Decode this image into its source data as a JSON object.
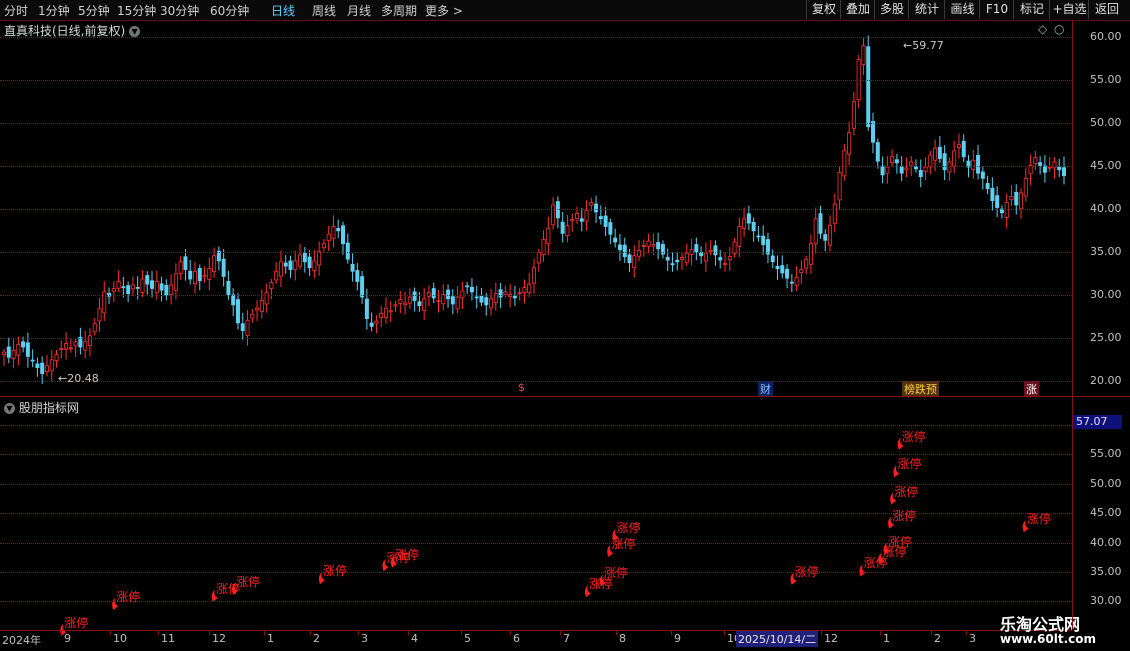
{
  "toolbar": {
    "periods": [
      "分时",
      "1分钟",
      "5分钟",
      "15分钟",
      "30分钟",
      "60分钟",
      "日线",
      "周线",
      "月线",
      "多周期",
      "更多 >"
    ],
    "active_period": "日线",
    "right_buttons": [
      "复权",
      "叠加",
      "多股",
      "统计",
      "画线",
      "F10",
      "标记",
      "+自选",
      "返回"
    ]
  },
  "chart_title": "直真科技(日线,前复权)",
  "sub_title": "股朋指标网",
  "main_annotations": {
    "high": "59.77",
    "low": "20.48"
  },
  "events": [
    "$",
    "财",
    "榜跌预",
    "涨"
  ],
  "current_value": "57.07",
  "limit_up_label": "涨停",
  "watermark": {
    "line1": "乐淘公式网",
    "line2": "www.60lt.com"
  },
  "crosshair_date": "2025/10/14/二",
  "colors": {
    "up": "#ff3030",
    "down": "#5ecff0",
    "grid": "#7a1a1a",
    "active": "#5fd0ff"
  },
  "chart_data": [
    {
      "type": "candlestick",
      "title": "直真科技(日线,前复权)",
      "y_ticks": [
        60.0,
        55.0,
        50.0,
        45.0,
        40.0,
        35.0,
        30.0,
        25.0,
        20.0
      ],
      "ylim": [
        18.3,
        62
      ],
      "x_ticks": [
        "2024年",
        "9",
        "10",
        "11",
        "12",
        "1",
        "2",
        "3",
        "4",
        "5",
        "6",
        "7",
        "8",
        "9",
        "10",
        "11",
        "12",
        "1",
        "2",
        "3"
      ],
      "close_path": [
        23.4,
        22.8,
        23.6,
        24.3,
        24.0,
        22.9,
        22.4,
        21.6,
        20.9,
        21.8,
        22.5,
        23.1,
        23.8,
        24.4,
        23.9,
        24.6,
        24.0,
        24.6,
        25.3,
        26.7,
        28.5,
        30.4,
        29.9,
        30.8,
        31.6,
        31.0,
        30.2,
        31.2,
        30.8,
        31.9,
        31.3,
        30.8,
        31.6,
        30.6,
        30.0,
        31.2,
        32.5,
        33.9,
        33.0,
        31.9,
        32.8,
        31.7,
        32.3,
        33.1,
        34.6,
        34.0,
        32.2,
        30.1,
        28.9,
        26.8,
        25.9,
        27.1,
        27.8,
        28.5,
        29.4,
        30.3,
        31.5,
        32.8,
        33.9,
        33.4,
        33.0,
        34.0,
        34.7,
        33.9,
        33.2,
        34.0,
        35.1,
        36.0,
        37.1,
        38.0,
        37.5,
        36.0,
        34.2,
        32.8,
        31.6,
        29.8,
        27.3,
        26.4,
        27.0,
        27.9,
        28.5,
        28.2,
        28.9,
        29.5,
        29.1,
        29.8,
        29.4,
        28.8,
        29.6,
        30.3,
        29.7,
        29.4,
        30.1,
        29.6,
        29.0,
        29.8,
        30.5,
        31.0,
        30.4,
        29.7,
        29.2,
        28.9,
        29.6,
        30.2,
        29.8,
        30.4,
        30.1,
        29.7,
        30.3,
        30.9,
        31.3,
        33.2,
        35.0,
        36.5,
        37.8,
        40.5,
        39.0,
        37.2,
        38.1,
        38.8,
        39.5,
        38.6,
        39.9,
        40.8,
        39.7,
        38.9,
        38.0,
        37.1,
        36.2,
        35.3,
        34.5,
        33.8,
        34.6,
        35.2,
        35.8,
        36.3,
        35.9,
        35.4,
        34.8,
        34.1,
        33.6,
        33.9,
        34.4,
        34.9,
        35.3,
        35.0,
        34.6,
        34.9,
        35.2,
        34.7,
        34.1,
        33.7,
        34.5,
        36.2,
        38.0,
        38.9,
        38.4,
        37.5,
        36.8,
        35.9,
        34.8,
        33.9,
        33.1,
        32.6,
        32.0,
        31.5,
        32.1,
        33.0,
        34.2,
        36.0,
        38.9,
        37.2,
        36.4,
        38.1,
        40.6,
        44.3,
        46.8,
        48.9,
        52.5,
        57.4,
        59.0,
        49.6,
        47.8,
        45.6,
        44.0,
        44.9,
        46.1,
        45.4,
        44.2,
        44.8,
        45.5,
        44.7,
        43.8,
        44.9,
        46.3,
        47.1,
        45.9,
        44.6,
        45.5,
        46.8,
        47.5,
        46.1,
        44.9,
        45.7,
        44.2,
        43.6,
        42.4,
        41.0,
        40.2,
        39.6,
        40.8,
        41.5,
        40.5,
        41.9,
        43.6,
        45.1,
        46.0,
        45.1,
        44.3,
        44.9,
        45.5,
        44.6,
        43.9
      ]
    },
    {
      "type": "indicator",
      "title": "股朋指标网",
      "y_ticks": [
        60.0,
        55.0,
        50.0,
        45.0,
        40.0,
        35.0,
        30.0
      ],
      "ylim": [
        25.5,
        61.8
      ],
      "limit_up_points": [
        {
          "x": 0.056,
          "y": 25.5
        },
        {
          "x": 0.105,
          "y": 29.9
        },
        {
          "x": 0.199,
          "y": 31.3
        },
        {
          "x": 0.218,
          "y": 32.5
        },
        {
          "x": 0.3,
          "y": 34.3
        },
        {
          "x": 0.36,
          "y": 36.5
        },
        {
          "x": 0.368,
          "y": 37.1
        },
        {
          "x": 0.551,
          "y": 32.1
        },
        {
          "x": 0.565,
          "y": 33.9
        },
        {
          "x": 0.572,
          "y": 38.9
        },
        {
          "x": 0.577,
          "y": 41.6
        },
        {
          "x": 0.745,
          "y": 34.2
        },
        {
          "x": 0.81,
          "y": 35.6
        },
        {
          "x": 0.828,
          "y": 37.6
        },
        {
          "x": 0.833,
          "y": 39.3
        },
        {
          "x": 0.837,
          "y": 43.7
        },
        {
          "x": 0.839,
          "y": 47.8
        },
        {
          "x": 0.842,
          "y": 52.4
        },
        {
          "x": 0.846,
          "y": 57.1
        },
        {
          "x": 0.964,
          "y": 43.1
        }
      ]
    }
  ]
}
